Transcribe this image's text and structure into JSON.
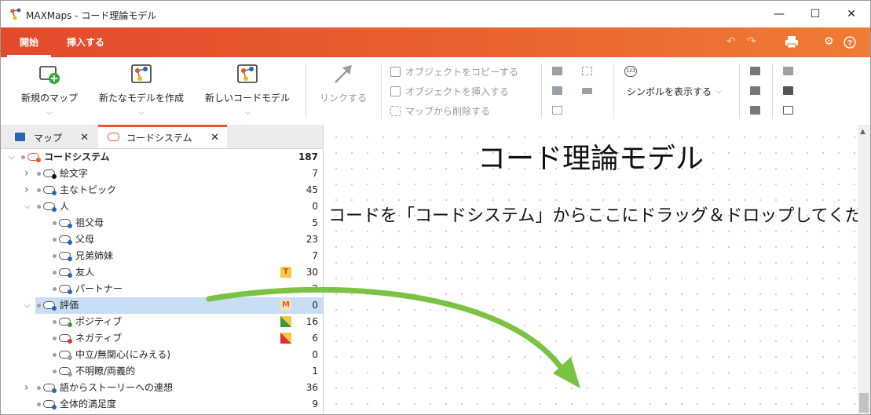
{
  "window": {
    "title": "MAXMaps - コード理論モデル",
    "minimize": "—",
    "maximize": "☐",
    "close": "✕"
  },
  "ribbon_tabs": [
    {
      "label": "開始"
    },
    {
      "label": "挿入する"
    }
  ],
  "ribbon": {
    "new_map": "新規のマップ",
    "new_model": "新たなモデルを作成",
    "new_code_model": "新しいコードモデル",
    "link": "リンクする",
    "copy_object": "オブジェクトをコピーする",
    "insert_object": "オブジェクトを挿入する",
    "delete_from_map": "マップから削除する",
    "show_symbols": "シンボルを表示する",
    "symbol_badge": "123"
  },
  "panel_tabs": [
    {
      "label": "マップ"
    },
    {
      "label": "コードシステム"
    }
  ],
  "tree": [
    {
      "label": "コードシステム",
      "count": "187",
      "bold": true,
      "level": 0,
      "arrow": "expanded",
      "color": "#e8562f",
      "root": true
    },
    {
      "label": "絵文字",
      "count": "7",
      "level": 1,
      "arrow": "collapsed",
      "color": "#111111"
    },
    {
      "label": "主なトピック",
      "count": "45",
      "level": 1,
      "arrow": "collapsed",
      "color": "#2a66b0"
    },
    {
      "label": "人",
      "count": "0",
      "level": 1,
      "arrow": "expanded",
      "color": "#2a66b0"
    },
    {
      "label": "祖父母",
      "count": "5",
      "level": 2,
      "color": "#2a66b0"
    },
    {
      "label": "父母",
      "count": "23",
      "level": 2,
      "color": "#2a66b0"
    },
    {
      "label": "兄弟姉妹",
      "count": "7",
      "level": 2,
      "color": "#2a66b0"
    },
    {
      "label": "友人",
      "count": "30",
      "level": 2,
      "color": "#2a66b0",
      "memo": "T"
    },
    {
      "label": "パートナー",
      "count": "2",
      "level": 2,
      "color": "#2a66b0"
    },
    {
      "label": "評価",
      "count": "0",
      "level": 1,
      "arrow": "expanded",
      "color": "#2a66b0",
      "memo": "M",
      "selected": true
    },
    {
      "label": "ポジティブ",
      "count": "16",
      "level": 2,
      "color": "#3a9a3a",
      "tri": "#3a9a3a"
    },
    {
      "label": "ネガティブ",
      "count": "6",
      "level": 2,
      "color": "#e03030",
      "tri": "#e03030"
    },
    {
      "label": "中立/無関心(にみえる)",
      "count": "0",
      "level": 2,
      "color": "#9a9a9a"
    },
    {
      "label": "不明瞭/両義的",
      "count": "1",
      "level": 2,
      "color": "#9a9a9a"
    },
    {
      "label": "語からストーリーへの連想",
      "count": "36",
      "level": 1,
      "arrow": "collapsed",
      "color": "#2a66b0"
    },
    {
      "label": "全体的満足度",
      "count": "9",
      "level": 1,
      "color": "#2a66b0"
    }
  ],
  "canvas": {
    "title": "コード理論モデル",
    "instruction": "コードを「コードシステム」からここにドラッグ＆ドロップしてください。"
  },
  "colors": {
    "accent": "#e8562f",
    "arrow": "#7cc242",
    "selection": "#c7def5"
  }
}
